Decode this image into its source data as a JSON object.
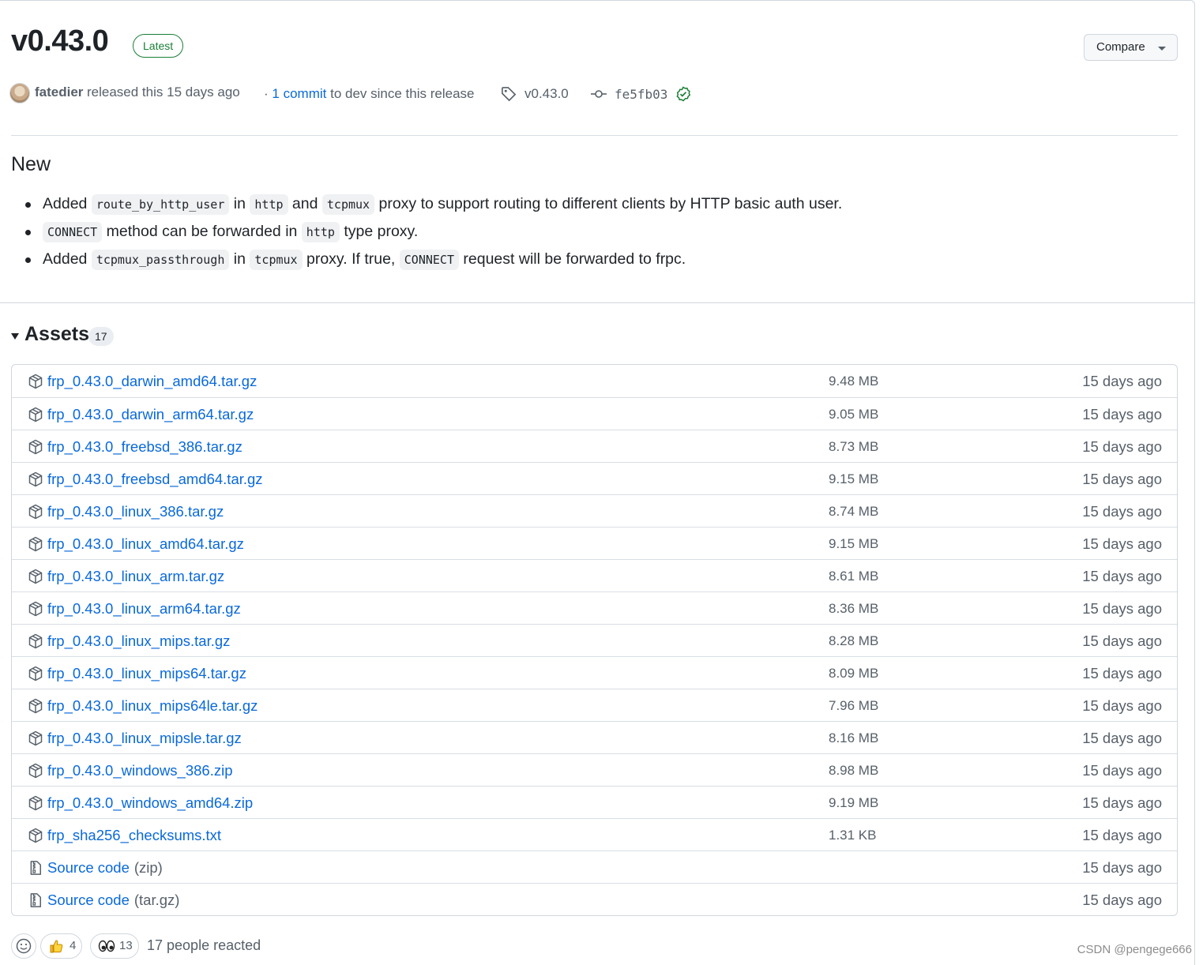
{
  "release": {
    "title": "v0.43.0",
    "badge": "Latest",
    "compare_label": "Compare",
    "author": "fatedier",
    "released_text": "released this 15 days ago",
    "commit_prefix": "·",
    "commit_link": "1 commit",
    "commit_suffix": "to dev since this release",
    "tag": "v0.43.0",
    "sha": "fe5fb03"
  },
  "notes": {
    "heading": "New",
    "items": [
      [
        {
          "t": "text",
          "v": "Added "
        },
        {
          "t": "code",
          "v": "route_by_http_user"
        },
        {
          "t": "text",
          "v": " in "
        },
        {
          "t": "code",
          "v": "http"
        },
        {
          "t": "text",
          "v": " and "
        },
        {
          "t": "code",
          "v": "tcpmux"
        },
        {
          "t": "text",
          "v": " proxy to support routing to different clients by HTTP basic auth user."
        }
      ],
      [
        {
          "t": "code",
          "v": "CONNECT"
        },
        {
          "t": "text",
          "v": " method can be forwarded in "
        },
        {
          "t": "code",
          "v": "http"
        },
        {
          "t": "text",
          "v": " type proxy."
        }
      ],
      [
        {
          "t": "text",
          "v": "Added "
        },
        {
          "t": "code",
          "v": "tcpmux_passthrough"
        },
        {
          "t": "text",
          "v": " in "
        },
        {
          "t": "code",
          "v": "tcpmux"
        },
        {
          "t": "text",
          "v": " proxy. If true, "
        },
        {
          "t": "code",
          "v": "CONNECT"
        },
        {
          "t": "text",
          "v": " request will be forwarded to frpc."
        }
      ]
    ]
  },
  "assets": {
    "label": "Assets",
    "count": "17",
    "items": [
      {
        "icon": "package-icon",
        "name": "frp_0.43.0_darwin_amd64.tar.gz",
        "ext": "",
        "size": "9.48 MB",
        "date": "15 days ago"
      },
      {
        "icon": "package-icon",
        "name": "frp_0.43.0_darwin_arm64.tar.gz",
        "ext": "",
        "size": "9.05 MB",
        "date": "15 days ago"
      },
      {
        "icon": "package-icon",
        "name": "frp_0.43.0_freebsd_386.tar.gz",
        "ext": "",
        "size": "8.73 MB",
        "date": "15 days ago"
      },
      {
        "icon": "package-icon",
        "name": "frp_0.43.0_freebsd_amd64.tar.gz",
        "ext": "",
        "size": "9.15 MB",
        "date": "15 days ago"
      },
      {
        "icon": "package-icon",
        "name": "frp_0.43.0_linux_386.tar.gz",
        "ext": "",
        "size": "8.74 MB",
        "date": "15 days ago"
      },
      {
        "icon": "package-icon",
        "name": "frp_0.43.0_linux_amd64.tar.gz",
        "ext": "",
        "size": "9.15 MB",
        "date": "15 days ago"
      },
      {
        "icon": "package-icon",
        "name": "frp_0.43.0_linux_arm.tar.gz",
        "ext": "",
        "size": "8.61 MB",
        "date": "15 days ago"
      },
      {
        "icon": "package-icon",
        "name": "frp_0.43.0_linux_arm64.tar.gz",
        "ext": "",
        "size": "8.36 MB",
        "date": "15 days ago"
      },
      {
        "icon": "package-icon",
        "name": "frp_0.43.0_linux_mips.tar.gz",
        "ext": "",
        "size": "8.28 MB",
        "date": "15 days ago"
      },
      {
        "icon": "package-icon",
        "name": "frp_0.43.0_linux_mips64.tar.gz",
        "ext": "",
        "size": "8.09 MB",
        "date": "15 days ago"
      },
      {
        "icon": "package-icon",
        "name": "frp_0.43.0_linux_mips64le.tar.gz",
        "ext": "",
        "size": "7.96 MB",
        "date": "15 days ago"
      },
      {
        "icon": "package-icon",
        "name": "frp_0.43.0_linux_mipsle.tar.gz",
        "ext": "",
        "size": "8.16 MB",
        "date": "15 days ago"
      },
      {
        "icon": "package-icon",
        "name": "frp_0.43.0_windows_386.zip",
        "ext": "",
        "size": "8.98 MB",
        "date": "15 days ago"
      },
      {
        "icon": "package-icon",
        "name": "frp_0.43.0_windows_amd64.zip",
        "ext": "",
        "size": "9.19 MB",
        "date": "15 days ago"
      },
      {
        "icon": "package-icon",
        "name": "frp_sha256_checksums.txt",
        "ext": "",
        "size": "1.31 KB",
        "date": "15 days ago"
      },
      {
        "icon": "file-zip-icon",
        "name": "Source code",
        "ext": "(zip)",
        "size": "",
        "date": "15 days ago"
      },
      {
        "icon": "file-zip-icon",
        "name": "Source code",
        "ext": "(tar.gz)",
        "size": "",
        "date": "15 days ago"
      }
    ]
  },
  "reactions": {
    "thumbs_up_count": "4",
    "eyes_count": "13",
    "summary": "17 people reacted"
  },
  "watermark": "CSDN @pengege666",
  "colors": {
    "link": "#0969da",
    "muted": "#57606a",
    "success": "#1a7f37",
    "border": "#d0d7de"
  }
}
